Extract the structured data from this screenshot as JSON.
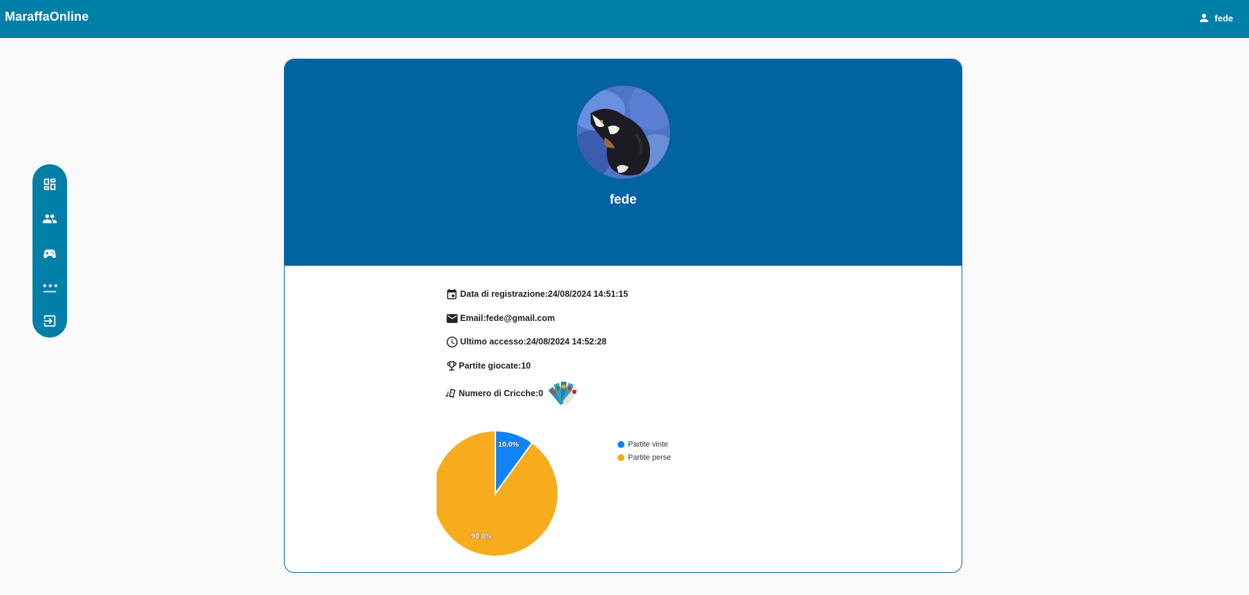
{
  "app": {
    "title": "MaraffaOnline"
  },
  "header": {
    "user_name": "fede",
    "user_icon": "person-icon"
  },
  "sidenav": {
    "items": [
      {
        "name": "dashboard",
        "icon": "dashboard-icon"
      },
      {
        "name": "friends",
        "icon": "people-icon"
      },
      {
        "name": "games",
        "icon": "gamepad-icon"
      },
      {
        "name": "password",
        "icon": "password-icon"
      },
      {
        "name": "logout",
        "icon": "logout-icon"
      }
    ]
  },
  "profile": {
    "name": "fede",
    "avatar_icon": "cat-photo",
    "details": [
      {
        "icon": "calendar-icon",
        "label": "Data di registrazione:",
        "value": "24/08/2024 14:51:15"
      },
      {
        "icon": "mail-icon",
        "label": "Email:",
        "value": "fede@gmail.com"
      },
      {
        "icon": "clock-icon",
        "label": "Ultimo accesso:",
        "value": "24/08/2024 14:52:28"
      },
      {
        "icon": "trophy-icon",
        "label": "Partite giocate:",
        "value": "10"
      },
      {
        "icon": "cards-icon",
        "label": "Numero di Cricche:",
        "value": "0"
      }
    ]
  },
  "chart_data": {
    "type": "pie",
    "categories": [
      "Partite vinte",
      "Partite perse"
    ],
    "values": [
      10.0,
      90.0
    ],
    "labels": [
      "10.0%",
      "90.0%"
    ],
    "colors": [
      "#1084f4",
      "#f6ac1c"
    ],
    "legend": "right"
  },
  "colors": {
    "topbar": "#007fa8",
    "card_header": "#0263a3",
    "sidenav": "#007fa8"
  }
}
